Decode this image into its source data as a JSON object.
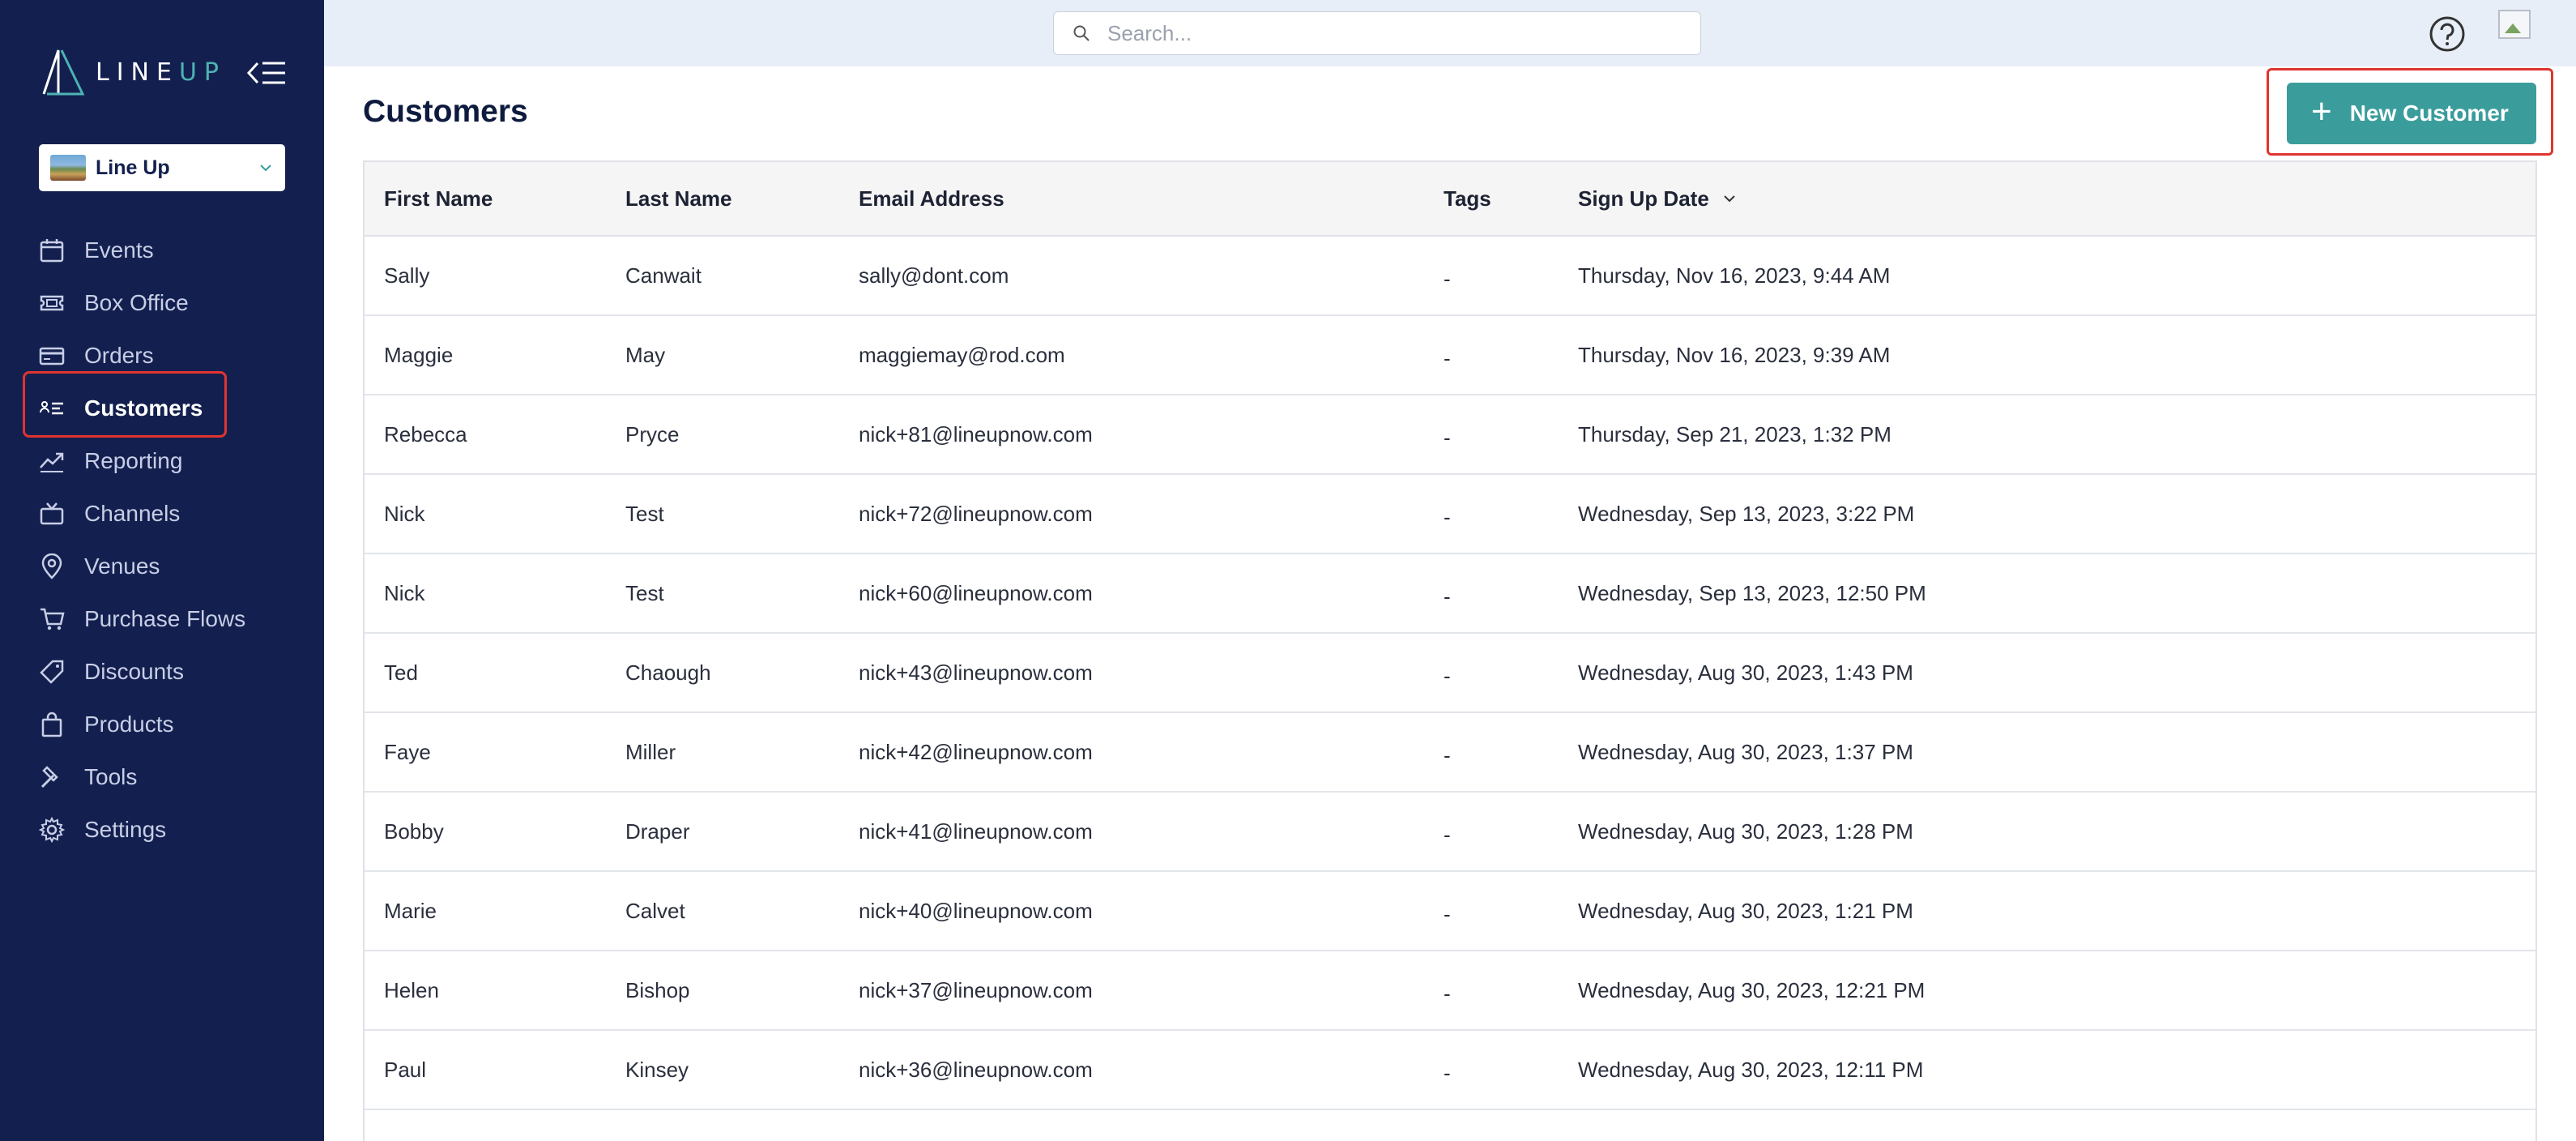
{
  "app": {
    "logo_text_main": "LINE",
    "logo_text_accent": "UP",
    "org_name": "Line Up"
  },
  "sidebar": {
    "items": [
      {
        "label": "Events",
        "icon": "calendar-icon"
      },
      {
        "label": "Box Office",
        "icon": "ticket-icon"
      },
      {
        "label": "Orders",
        "icon": "credit-card-icon"
      },
      {
        "label": "Customers",
        "icon": "customer-list-icon",
        "active": true
      },
      {
        "label": "Reporting",
        "icon": "trend-icon"
      },
      {
        "label": "Channels",
        "icon": "tv-icon"
      },
      {
        "label": "Venues",
        "icon": "map-pin-icon"
      },
      {
        "label": "Purchase Flows",
        "icon": "cart-icon"
      },
      {
        "label": "Discounts",
        "icon": "tag-icon"
      },
      {
        "label": "Products",
        "icon": "bag-icon"
      },
      {
        "label": "Tools",
        "icon": "hammer-icon"
      },
      {
        "label": "Settings",
        "icon": "gear-icon"
      }
    ]
  },
  "search": {
    "placeholder": "Search..."
  },
  "page": {
    "title": "Customers",
    "new_button": "New Customer"
  },
  "table": {
    "headers": [
      "First Name",
      "Last Name",
      "Email Address",
      "Tags",
      "Sign Up Date"
    ],
    "rows": [
      [
        "Sally",
        "Canwait",
        "sally@dont.com",
        "-",
        "Thursday, Nov 16, 2023, 9:44 AM"
      ],
      [
        "Maggie",
        "May",
        "maggiemay@rod.com",
        "-",
        "Thursday, Nov 16, 2023, 9:39 AM"
      ],
      [
        "Rebecca",
        "Pryce",
        "nick+81@lineupnow.com",
        "-",
        "Thursday, Sep 21, 2023, 1:32 PM"
      ],
      [
        "Nick",
        "Test",
        "nick+72@lineupnow.com",
        "-",
        "Wednesday, Sep 13, 2023, 3:22 PM"
      ],
      [
        "Nick",
        "Test",
        "nick+60@lineupnow.com",
        "-",
        "Wednesday, Sep 13, 2023, 12:50 PM"
      ],
      [
        "Ted",
        "Chaough",
        "nick+43@lineupnow.com",
        "-",
        "Wednesday, Aug 30, 2023, 1:43 PM"
      ],
      [
        "Faye",
        "Miller",
        "nick+42@lineupnow.com",
        "-",
        "Wednesday, Aug 30, 2023, 1:37 PM"
      ],
      [
        "Bobby",
        "Draper",
        "nick+41@lineupnow.com",
        "-",
        "Wednesday, Aug 30, 2023, 1:28 PM"
      ],
      [
        "Marie",
        "Calvet",
        "nick+40@lineupnow.com",
        "-",
        "Wednesday, Aug 30, 2023, 1:21 PM"
      ],
      [
        "Helen",
        "Bishop",
        "nick+37@lineupnow.com",
        "-",
        "Wednesday, Aug 30, 2023, 12:21 PM"
      ],
      [
        "Paul",
        "Kinsey",
        "nick+36@lineupnow.com",
        "-",
        "Wednesday, Aug 30, 2023, 12:11 PM"
      ]
    ]
  },
  "colors": {
    "sidebar_bg": "#13204f",
    "topbar_bg": "#e8eef8",
    "accent": "#3b9c9c",
    "highlight": "#e0342f"
  }
}
